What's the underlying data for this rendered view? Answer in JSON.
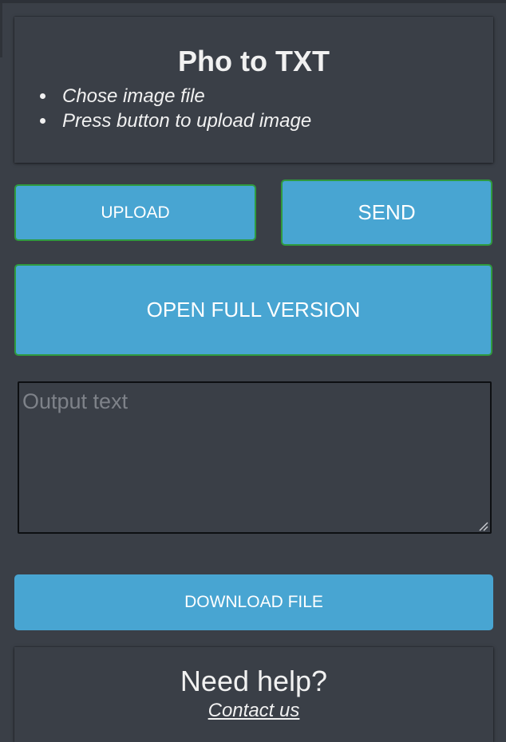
{
  "header": {
    "title": "Pho to TXT",
    "instructions": [
      "Chose image file",
      "Press button to upload image"
    ]
  },
  "buttons": {
    "upload_label": "UPLOAD",
    "send_label": "SEND",
    "open_full_label": "OPEN FULL VERSION",
    "download_label": "DOWNLOAD FILE"
  },
  "output": {
    "placeholder": "Output text",
    "value": ""
  },
  "help": {
    "title": "Need help?",
    "link_label": "Contact us"
  },
  "colors": {
    "background": "#3a3f47",
    "button": "#48a5d2",
    "button_border": "#2f9a3f",
    "text": "#f1f1f1"
  }
}
